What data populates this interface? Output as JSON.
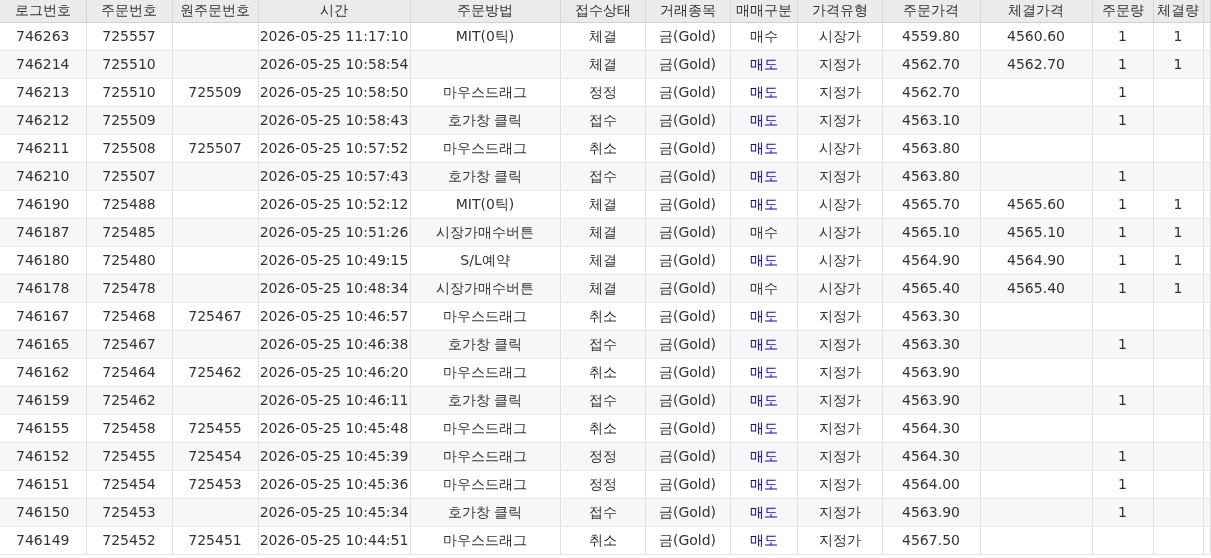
{
  "table": {
    "columns": [
      "로그번호",
      "주문번호",
      "원주문번호",
      "시간",
      "주문방법",
      "접수상태",
      "거래종목",
      "매매구분",
      "가격유형",
      "주문가격",
      "체결가격",
      "주문량",
      "체결량"
    ],
    "rows": [
      {
        "color": "#333333",
        "cells": [
          "746263",
          "725557",
          null,
          "2026-05-25 11:17:10",
          "MIT(0틱)",
          "체결",
          "금(Gold)",
          "매수",
          "시장가",
          "4559.80",
          "4560.60",
          "1",
          "1"
        ]
      },
      {
        "color": "#0000ff",
        "cells": [
          "746214",
          "725510",
          null,
          "2026-05-25 10:58:54",
          null,
          "체결",
          "금(Gold)",
          "매도",
          "지정가",
          "4562.70",
          "4562.70",
          "1",
          "1"
        ]
      },
      {
        "color": "#0000ff",
        "cells": [
          "746213",
          "725510",
          "725509",
          "2026-05-25 10:58:50",
          "마우스드래그",
          "정정",
          "금(Gold)",
          "매도",
          "지정가",
          "4562.70",
          null,
          "1",
          null
        ]
      },
      {
        "color": "#0000ff",
        "cells": [
          "746212",
          "725509",
          null,
          "2026-05-25 10:58:43",
          "호가창 클릭",
          "접수",
          "금(Gold)",
          "매도",
          "지정가",
          "4563.10",
          null,
          "1",
          null
        ]
      },
      {
        "color": "#0000ff",
        "cells": [
          "746211",
          "725508",
          "725507",
          "2026-05-25 10:57:52",
          "마우스드래그",
          "취소",
          "금(Gold)",
          "매도",
          "시장가",
          "4563.80",
          null,
          null,
          null
        ]
      },
      {
        "color": "#0000ff",
        "cells": [
          "746210",
          "725507",
          null,
          "2026-05-25 10:57:43",
          "호가창 클릭",
          "접수",
          "금(Gold)",
          "매도",
          "지정가",
          "4563.80",
          null,
          "1",
          null
        ]
      },
      {
        "color": "#0000ff",
        "cells": [
          "746190",
          "725488",
          null,
          "2026-05-25 10:52:12",
          "MIT(0틱)",
          "체결",
          "금(Gold)",
          "매도",
          "시장가",
          "4565.70",
          "4565.60",
          "1",
          "1"
        ]
      },
      {
        "color": "#333333",
        "cells": [
          "746187",
          "725485",
          null,
          "2026-05-25 10:51:26",
          "시장가매수버튼",
          "체결",
          "금(Gold)",
          "매수",
          "시장가",
          "4565.10",
          "4565.10",
          "1",
          "1"
        ]
      },
      {
        "color": "#0000ff",
        "cells": [
          "746180",
          "725480",
          null,
          "2026-05-25 10:49:15",
          "S/L예약",
          "체결",
          "금(Gold)",
          "매도",
          "시장가",
          "4564.90",
          "4564.90",
          "1",
          "1"
        ]
      },
      {
        "color": "#333333",
        "cells": [
          "746178",
          "725478",
          null,
          "2026-05-25 10:48:34",
          "시장가매수버튼",
          "체결",
          "금(Gold)",
          "매수",
          "시장가",
          "4565.40",
          "4565.40",
          "1",
          "1"
        ]
      },
      {
        "color": "#0000ff",
        "cells": [
          "746167",
          "725468",
          "725467",
          "2026-05-25 10:46:57",
          "마우스드래그",
          "취소",
          "금(Gold)",
          "매도",
          "지정가",
          "4563.30",
          null,
          null,
          null
        ]
      },
      {
        "color": "#0000ff",
        "cells": [
          "746165",
          "725467",
          null,
          "2026-05-25 10:46:38",
          "호가창 클릭",
          "접수",
          "금(Gold)",
          "매도",
          "지정가",
          "4563.30",
          null,
          "1",
          null
        ]
      },
      {
        "color": "#0000ff",
        "cells": [
          "746162",
          "725464",
          "725462",
          "2026-05-25 10:46:20",
          "마우스드래그",
          "취소",
          "금(Gold)",
          "매도",
          "지정가",
          "4563.90",
          null,
          null,
          null
        ]
      },
      {
        "color": "#0000ff",
        "cells": [
          "746159",
          "725462",
          null,
          "2026-05-25 10:46:11",
          "호가창 클릭",
          "접수",
          "금(Gold)",
          "매도",
          "지정가",
          "4563.90",
          null,
          "1",
          null
        ]
      },
      {
        "color": "#0000ff",
        "cells": [
          "746155",
          "725458",
          "725455",
          "2026-05-25 10:45:48",
          "마우스드래그",
          "취소",
          "금(Gold)",
          "매도",
          "지정가",
          "4564.30",
          null,
          null,
          null
        ]
      },
      {
        "color": "#0000ff",
        "cells": [
          "746152",
          "725455",
          "725454",
          "2026-05-25 10:45:39",
          "마우스드래그",
          "정정",
          "금(Gold)",
          "매도",
          "지정가",
          "4564.30",
          null,
          "1",
          null
        ]
      },
      {
        "color": "#0000ff",
        "cells": [
          "746151",
          "725454",
          "725453",
          "2026-05-25 10:45:36",
          "마우스드래그",
          "정정",
          "금(Gold)",
          "매도",
          "지정가",
          "4564.00",
          null,
          "1",
          null
        ]
      },
      {
        "color": "#0000ff",
        "cells": [
          "746150",
          "725453",
          null,
          "2026-05-25 10:45:34",
          "호가창 클릭",
          "접수",
          "금(Gold)",
          "매도",
          "지정가",
          "4563.90",
          null,
          "1",
          null
        ]
      },
      {
        "color": "#0000ff",
        "cells": [
          "746149",
          "725452",
          "725451",
          "2026-05-25 10:44:51",
          "마우스드래그",
          "취소",
          "금(Gold)",
          "매도",
          "지정가",
          "4567.50",
          null,
          null,
          null
        ]
      }
    ]
  }
}
